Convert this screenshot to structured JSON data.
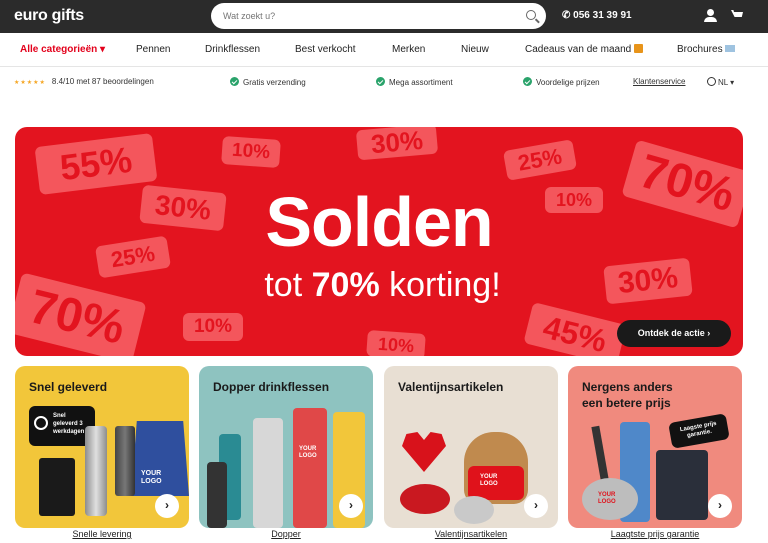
{
  "header": {
    "logo": "euro gifts",
    "search_placeholder": "Wat zoekt u?",
    "phone": "056 31 39 91"
  },
  "nav": {
    "items": [
      "Alle categorieën",
      "Pennen",
      "Drinkflessen",
      "Best verkocht",
      "Merken",
      "Nieuw",
      "Cadeaus van de maand",
      "Brochures"
    ]
  },
  "usp": {
    "rating": "8.4/10 met 87 beoordelingen",
    "shipping": "Gratis verzending",
    "assortment": "Mega assortiment",
    "prices": "Voordelige prijzen",
    "service": "Klantenservice",
    "language": "NL"
  },
  "hero": {
    "title": "Solden",
    "sub_prefix": "tot",
    "sub_bold": "70%",
    "sub_suffix": "korting!",
    "cta": "Ontdek de actie",
    "tags": [
      "55%",
      "10%",
      "30%",
      "25%",
      "70%",
      "30%",
      "10%",
      "25%",
      "70%",
      "10%",
      "10%",
      "45%",
      "30%"
    ]
  },
  "cards": [
    {
      "title": "Snel geleverd",
      "link": "Snelle levering",
      "badge": "Snel geleverd 3 werkdagen",
      "logo": "YOUR LOGO"
    },
    {
      "title": "Dopper drinkflessen",
      "link": "Dopper",
      "logo": "YOUR LOGO"
    },
    {
      "title": "Valentijnsartikelen",
      "link": "Valentijnsartikelen",
      "logo": "YOUR LOGO"
    },
    {
      "title": "Nergens anders een betere prijs",
      "link": "Laagtste prijs garantie",
      "badge": "Laagste prijs garantie.",
      "logo": "YOUR LOGO"
    }
  ],
  "colors": {
    "brand_red": "#e3141f",
    "dark": "#2b2b2b",
    "check_green": "#2aa36b"
  }
}
